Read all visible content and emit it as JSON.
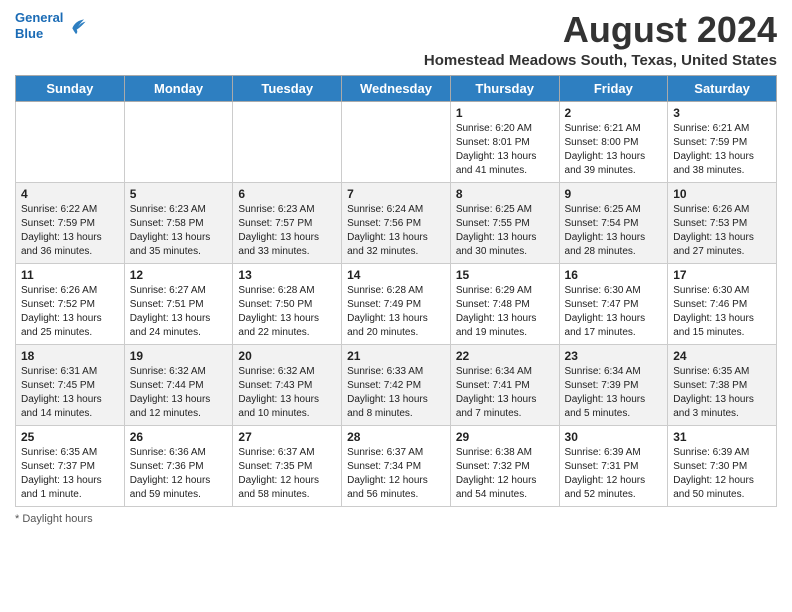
{
  "header": {
    "logo_line1": "General",
    "logo_line2": "Blue",
    "main_title": "August 2024",
    "subtitle": "Homestead Meadows South, Texas, United States"
  },
  "weekdays": [
    "Sunday",
    "Monday",
    "Tuesday",
    "Wednesday",
    "Thursday",
    "Friday",
    "Saturday"
  ],
  "footer": {
    "daylight_label": "Daylight hours"
  },
  "weeks": [
    [
      {
        "day": "",
        "sunrise": "",
        "sunset": "",
        "daylight": ""
      },
      {
        "day": "",
        "sunrise": "",
        "sunset": "",
        "daylight": ""
      },
      {
        "day": "",
        "sunrise": "",
        "sunset": "",
        "daylight": ""
      },
      {
        "day": "",
        "sunrise": "",
        "sunset": "",
        "daylight": ""
      },
      {
        "day": "1",
        "sunrise": "Sunrise: 6:20 AM",
        "sunset": "Sunset: 8:01 PM",
        "daylight": "Daylight: 13 hours and 41 minutes."
      },
      {
        "day": "2",
        "sunrise": "Sunrise: 6:21 AM",
        "sunset": "Sunset: 8:00 PM",
        "daylight": "Daylight: 13 hours and 39 minutes."
      },
      {
        "day": "3",
        "sunrise": "Sunrise: 6:21 AM",
        "sunset": "Sunset: 7:59 PM",
        "daylight": "Daylight: 13 hours and 38 minutes."
      }
    ],
    [
      {
        "day": "4",
        "sunrise": "Sunrise: 6:22 AM",
        "sunset": "Sunset: 7:59 PM",
        "daylight": "Daylight: 13 hours and 36 minutes."
      },
      {
        "day": "5",
        "sunrise": "Sunrise: 6:23 AM",
        "sunset": "Sunset: 7:58 PM",
        "daylight": "Daylight: 13 hours and 35 minutes."
      },
      {
        "day": "6",
        "sunrise": "Sunrise: 6:23 AM",
        "sunset": "Sunset: 7:57 PM",
        "daylight": "Daylight: 13 hours and 33 minutes."
      },
      {
        "day": "7",
        "sunrise": "Sunrise: 6:24 AM",
        "sunset": "Sunset: 7:56 PM",
        "daylight": "Daylight: 13 hours and 32 minutes."
      },
      {
        "day": "8",
        "sunrise": "Sunrise: 6:25 AM",
        "sunset": "Sunset: 7:55 PM",
        "daylight": "Daylight: 13 hours and 30 minutes."
      },
      {
        "day": "9",
        "sunrise": "Sunrise: 6:25 AM",
        "sunset": "Sunset: 7:54 PM",
        "daylight": "Daylight: 13 hours and 28 minutes."
      },
      {
        "day": "10",
        "sunrise": "Sunrise: 6:26 AM",
        "sunset": "Sunset: 7:53 PM",
        "daylight": "Daylight: 13 hours and 27 minutes."
      }
    ],
    [
      {
        "day": "11",
        "sunrise": "Sunrise: 6:26 AM",
        "sunset": "Sunset: 7:52 PM",
        "daylight": "Daylight: 13 hours and 25 minutes."
      },
      {
        "day": "12",
        "sunrise": "Sunrise: 6:27 AM",
        "sunset": "Sunset: 7:51 PM",
        "daylight": "Daylight: 13 hours and 24 minutes."
      },
      {
        "day": "13",
        "sunrise": "Sunrise: 6:28 AM",
        "sunset": "Sunset: 7:50 PM",
        "daylight": "Daylight: 13 hours and 22 minutes."
      },
      {
        "day": "14",
        "sunrise": "Sunrise: 6:28 AM",
        "sunset": "Sunset: 7:49 PM",
        "daylight": "Daylight: 13 hours and 20 minutes."
      },
      {
        "day": "15",
        "sunrise": "Sunrise: 6:29 AM",
        "sunset": "Sunset: 7:48 PM",
        "daylight": "Daylight: 13 hours and 19 minutes."
      },
      {
        "day": "16",
        "sunrise": "Sunrise: 6:30 AM",
        "sunset": "Sunset: 7:47 PM",
        "daylight": "Daylight: 13 hours and 17 minutes."
      },
      {
        "day": "17",
        "sunrise": "Sunrise: 6:30 AM",
        "sunset": "Sunset: 7:46 PM",
        "daylight": "Daylight: 13 hours and 15 minutes."
      }
    ],
    [
      {
        "day": "18",
        "sunrise": "Sunrise: 6:31 AM",
        "sunset": "Sunset: 7:45 PM",
        "daylight": "Daylight: 13 hours and 14 minutes."
      },
      {
        "day": "19",
        "sunrise": "Sunrise: 6:32 AM",
        "sunset": "Sunset: 7:44 PM",
        "daylight": "Daylight: 13 hours and 12 minutes."
      },
      {
        "day": "20",
        "sunrise": "Sunrise: 6:32 AM",
        "sunset": "Sunset: 7:43 PM",
        "daylight": "Daylight: 13 hours and 10 minutes."
      },
      {
        "day": "21",
        "sunrise": "Sunrise: 6:33 AM",
        "sunset": "Sunset: 7:42 PM",
        "daylight": "Daylight: 13 hours and 8 minutes."
      },
      {
        "day": "22",
        "sunrise": "Sunrise: 6:34 AM",
        "sunset": "Sunset: 7:41 PM",
        "daylight": "Daylight: 13 hours and 7 minutes."
      },
      {
        "day": "23",
        "sunrise": "Sunrise: 6:34 AM",
        "sunset": "Sunset: 7:39 PM",
        "daylight": "Daylight: 13 hours and 5 minutes."
      },
      {
        "day": "24",
        "sunrise": "Sunrise: 6:35 AM",
        "sunset": "Sunset: 7:38 PM",
        "daylight": "Daylight: 13 hours and 3 minutes."
      }
    ],
    [
      {
        "day": "25",
        "sunrise": "Sunrise: 6:35 AM",
        "sunset": "Sunset: 7:37 PM",
        "daylight": "Daylight: 13 hours and 1 minute."
      },
      {
        "day": "26",
        "sunrise": "Sunrise: 6:36 AM",
        "sunset": "Sunset: 7:36 PM",
        "daylight": "Daylight: 12 hours and 59 minutes."
      },
      {
        "day": "27",
        "sunrise": "Sunrise: 6:37 AM",
        "sunset": "Sunset: 7:35 PM",
        "daylight": "Daylight: 12 hours and 58 minutes."
      },
      {
        "day": "28",
        "sunrise": "Sunrise: 6:37 AM",
        "sunset": "Sunset: 7:34 PM",
        "daylight": "Daylight: 12 hours and 56 minutes."
      },
      {
        "day": "29",
        "sunrise": "Sunrise: 6:38 AM",
        "sunset": "Sunset: 7:32 PM",
        "daylight": "Daylight: 12 hours and 54 minutes."
      },
      {
        "day": "30",
        "sunrise": "Sunrise: 6:39 AM",
        "sunset": "Sunset: 7:31 PM",
        "daylight": "Daylight: 12 hours and 52 minutes."
      },
      {
        "day": "31",
        "sunrise": "Sunrise: 6:39 AM",
        "sunset": "Sunset: 7:30 PM",
        "daylight": "Daylight: 12 hours and 50 minutes."
      }
    ]
  ]
}
